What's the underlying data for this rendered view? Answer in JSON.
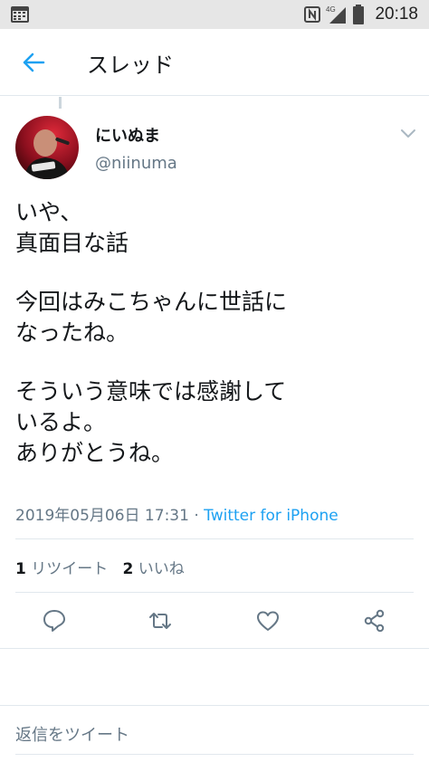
{
  "status_bar": {
    "time": "20:18",
    "network": "4G"
  },
  "header": {
    "title": "スレッド"
  },
  "tweet": {
    "display_name": "にいぬま",
    "handle": "@niinuma",
    "lines": [
      "いや、",
      "真面目な話",
      "",
      "今回はみこちゃんに世話に",
      "なったね。",
      "",
      "そういう意味では感謝して",
      "いるよ。",
      "ありがとうね。"
    ],
    "timestamp": "2019年05月06日 17:31",
    "separator": " · ",
    "source": "Twitter for iPhone",
    "retweet_count": "1",
    "retweet_label": "リツイート",
    "like_count": "2",
    "like_label": "いいね"
  },
  "reply": {
    "placeholder": "返信をツイート"
  },
  "colors": {
    "accent": "#1da1f2",
    "secondary_text": "#657786",
    "icon_gray": "#657786"
  }
}
